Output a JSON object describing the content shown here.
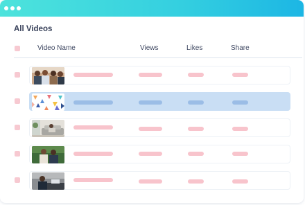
{
  "heading": "All Videos",
  "table": {
    "columns": [
      "Video Name",
      "Views",
      "Likes",
      "Share"
    ],
    "rows": [
      {
        "thumbnail": "people-photo",
        "selected": false
      },
      {
        "thumbnail": "triangle-pattern",
        "selected": true
      },
      {
        "thumbnail": "sofa-photo",
        "selected": false
      },
      {
        "thumbnail": "couple-photo",
        "selected": false
      },
      {
        "thumbnail": "man-at-desk-photo",
        "selected": false
      }
    ]
  },
  "colors": {
    "titlebar_start": "#4de3dc",
    "titlebar_end": "#1cb6e4",
    "placeholder_pink": "#f8c4cc",
    "placeholder_blue": "#9bbde6",
    "selected_row": "#c9def4"
  }
}
